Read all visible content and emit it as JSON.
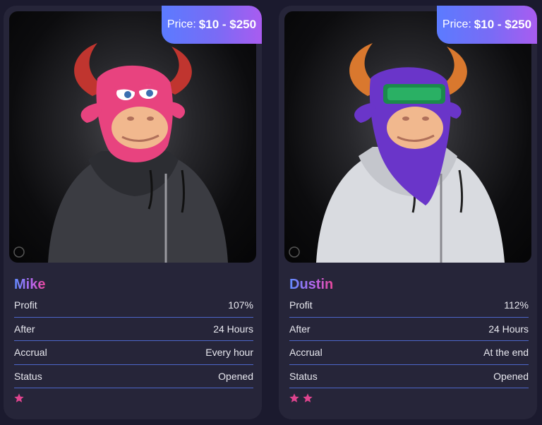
{
  "cards": [
    {
      "price_label": "Price:",
      "price_range": "$10 - $250",
      "name": "Mike",
      "rows": [
        {
          "label": "Profit",
          "value": "107%"
        },
        {
          "label": "After",
          "value": "24 Hours"
        },
        {
          "label": "Accrual",
          "value": "Every hour"
        },
        {
          "label": "Status",
          "value": "Opened"
        }
      ],
      "stars": 1,
      "colors": {
        "head": "#e8437f",
        "hoodie": "#3b3c42"
      }
    },
    {
      "price_label": "Price:",
      "price_range": "$10 - $250",
      "name": "Dustin",
      "rows": [
        {
          "label": "Profit",
          "value": "112%"
        },
        {
          "label": "After",
          "value": "24 Hours"
        },
        {
          "label": "Accrual",
          "value": "At the end"
        },
        {
          "label": "Status",
          "value": "Opened"
        }
      ],
      "stars": 2,
      "colors": {
        "head": "#6a35c9",
        "hoodie": "#d9dbe0"
      }
    }
  ],
  "accent_colors": {
    "star": "#e0448f",
    "divider": "#4d66c9",
    "price_gradient_start": "#5b7bff",
    "price_gradient_end": "#a95cf0"
  }
}
